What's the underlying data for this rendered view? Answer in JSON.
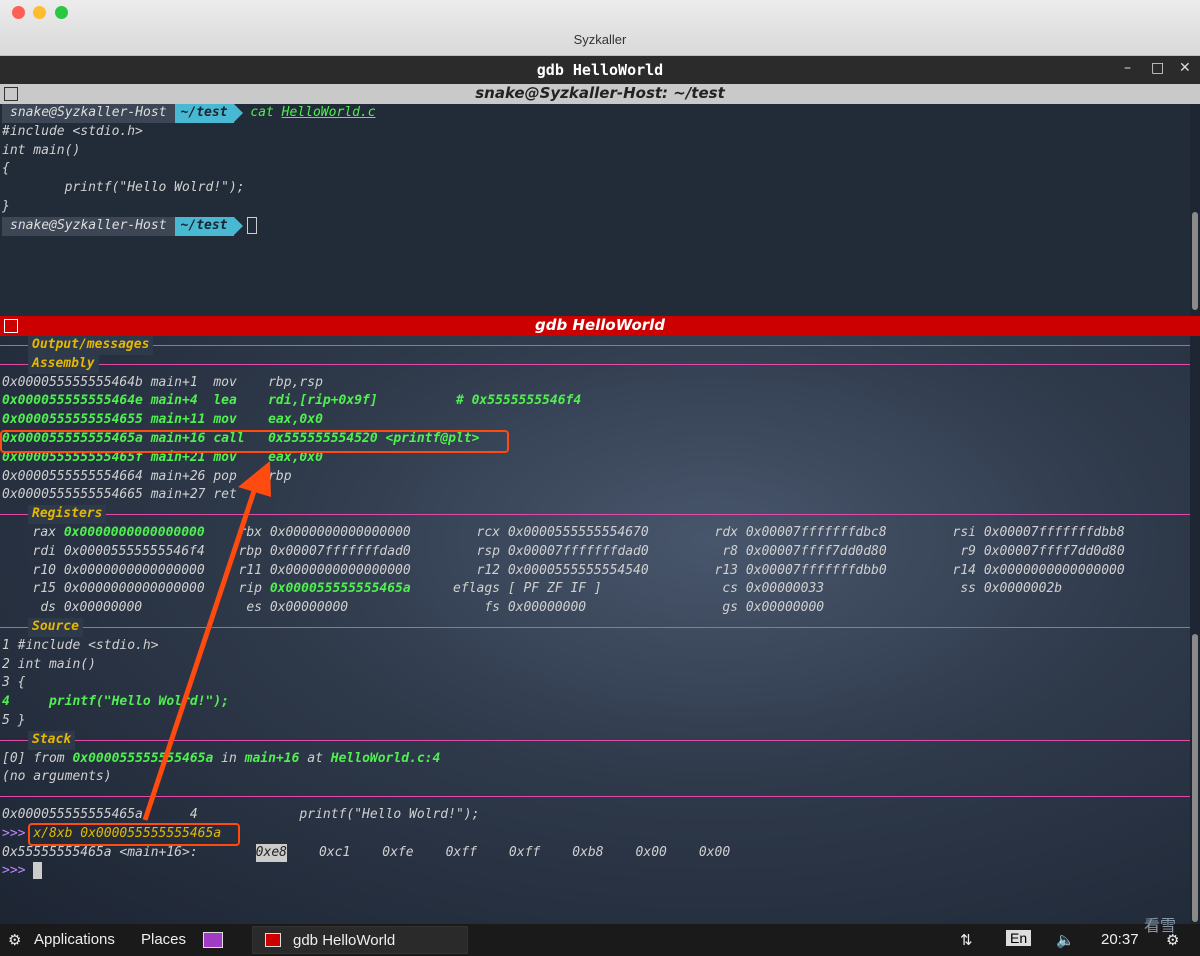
{
  "window": {
    "title": "Syzkaller",
    "term_title": "gdb HelloWorld",
    "pane1_title": "snake@Syzkaller-Host: ~/test",
    "pane2_title": "gdb HelloWorld"
  },
  "controls": {
    "minimize": "–",
    "maximize": "□",
    "close": "✕"
  },
  "pane1": {
    "user": "snake@Syzkaller-Host",
    "dir": "~/test",
    "cmd": "cat",
    "arg": "HelloWorld.c",
    "lines": [
      "#include <stdio.h>",
      "int main()",
      "{",
      "        printf(\"Hello Wolrd!\");",
      "}"
    ]
  },
  "gdb": {
    "sections": [
      "Output/messages",
      "Assembly",
      "Registers",
      "Source",
      "Stack"
    ],
    "assembly": [
      {
        "addr": "0x000055555555464b",
        "off": "main+1",
        "op": "mov",
        "args": "rbp,rsp",
        "comment": "",
        "hl": false
      },
      {
        "addr": "0x000055555555464e",
        "off": "main+4",
        "op": "lea",
        "args": "rdi,[rip+0x9f]",
        "comment": "# 0x5555555546f4",
        "hl": true
      },
      {
        "addr": "0x0000555555554655",
        "off": "main+11",
        "op": "mov",
        "args": "eax,0x0",
        "comment": "",
        "hl": true
      },
      {
        "addr": "0x000055555555465a",
        "off": "main+16",
        "op": "call",
        "args": "0x555555554520 <printf@plt>",
        "comment": "",
        "hl": true
      },
      {
        "addr": "0x000055555555465f",
        "off": "main+21",
        "op": "mov",
        "args": "eax,0x0",
        "comment": "",
        "hl": true
      },
      {
        "addr": "0x0000555555554664",
        "off": "main+26",
        "op": "pop",
        "args": "rbp",
        "comment": "",
        "hl": false
      },
      {
        "addr": "0x0000555555554665",
        "off": "main+27",
        "op": "ret",
        "args": "",
        "comment": "",
        "hl": false
      }
    ],
    "registers": [
      [
        [
          "rax",
          "0x0000000000000000"
        ],
        [
          "rbx",
          "0x0000000000000000"
        ],
        [
          "rcx",
          "0x0000555555554670"
        ],
        [
          "rdx",
          "0x00007fffffffdbc8"
        ],
        [
          "rsi",
          "0x00007fffffffdbb8"
        ]
      ],
      [
        [
          "rdi",
          "0x00005555555546f4"
        ],
        [
          "rbp",
          "0x00007fffffffdad0"
        ],
        [
          "rsp",
          "0x00007fffffffdad0"
        ],
        [
          "r8",
          "0x00007ffff7dd0d80"
        ],
        [
          "r9",
          "0x00007ffff7dd0d80"
        ]
      ],
      [
        [
          "r10",
          "0x0000000000000000"
        ],
        [
          "r11",
          "0x0000000000000000"
        ],
        [
          "r12",
          "0x0000555555554540"
        ],
        [
          "r13",
          "0x00007fffffffdbb0"
        ],
        [
          "r14",
          "0x0000000000000000"
        ]
      ],
      [
        [
          "r15",
          "0x0000000000000000"
        ],
        [
          "rip",
          "0x000055555555465a"
        ],
        [
          "eflags",
          "[ PF ZF IF ]"
        ],
        [
          "cs",
          "0x00000033"
        ],
        [
          "ss",
          "0x0000002b"
        ]
      ],
      [
        [
          "ds",
          "0x00000000"
        ],
        [
          "es",
          "0x00000000"
        ],
        [
          "fs",
          "0x00000000"
        ],
        [
          "gs",
          "0x00000000"
        ],
        [
          "",
          ""
        ]
      ]
    ],
    "source": [
      "1 #include <stdio.h>",
      "2 int main()",
      "3 {",
      "4     printf(\"Hello Wolrd!\");",
      "5 }"
    ],
    "stack": {
      "idx": "[0]",
      "from": "from",
      "addr": "0x000055555555465a",
      "in": "in",
      "fn": "main+16",
      "at": "at",
      "loc": "HelloWorld.c:4",
      "args": "(no arguments)"
    },
    "out1": "0x000055555555465a      4             printf(\"Hello Wolrd!\");",
    "prompt": ">>>",
    "cmd": "x/8xb 0x000055555555465a",
    "dump_label": "0x55555555465a <main+16>:",
    "bytes": [
      "0xe8",
      "0xc1",
      "0xfe",
      "0xff",
      "0xff",
      "0xb8",
      "0x00",
      "0x00"
    ]
  },
  "taskbar": {
    "apps": "Applications",
    "places": "Places",
    "task": "gdb HelloWorld",
    "lang": "En",
    "time": "20:37",
    "watermark": "看雪"
  },
  "colors": {
    "accent": "#cc0000",
    "gdb_green": "#4ff04f",
    "section": "#e6b800",
    "rule": "#e04aa8",
    "annot": "#ff4a10"
  }
}
